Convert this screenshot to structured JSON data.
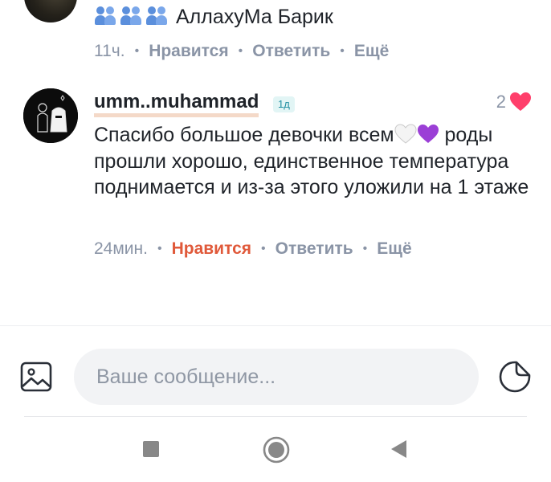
{
  "previous_comment": {
    "text": "АллахуМа Барик",
    "emoji_icons": [
      "people-holding-hands-icon",
      "people-holding-hands-icon",
      "people-holding-hands-icon"
    ],
    "time": "11ч.",
    "like_label": "Нравится",
    "reply_label": "Ответить",
    "more_label": "Ещё"
  },
  "comment": {
    "username": "umm..muhammad",
    "badge": "1д",
    "likes_count": "2",
    "text_before_emoji": "Спасибо большое девочки всем",
    "emoji_icons": [
      "white-heart-icon",
      "purple-heart-icon"
    ],
    "text_after_emoji": " роды прошли хорошо, единственное температура поднимается и из-за этого уложили на 1 этаже",
    "time": "24мин.",
    "like_label": "Нравится",
    "reply_label": "Ответить",
    "more_label": "Ещё",
    "liked": true
  },
  "composer": {
    "placeholder": "Ваше сообщение..."
  },
  "colors": {
    "accent_liked": "#e0593a",
    "heart": "#ff3f6b",
    "meta_text": "#8a94a6",
    "badge_bg": "#e2f5f5",
    "badge_text": "#1f8ea1"
  }
}
